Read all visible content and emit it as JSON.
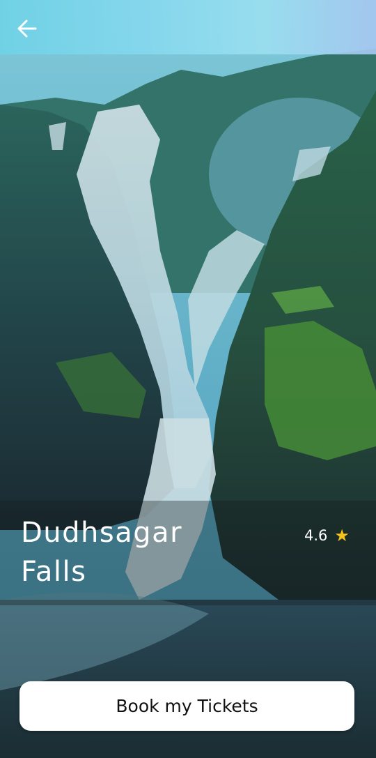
{
  "header": {
    "back_icon": "arrow-left-icon"
  },
  "place": {
    "name": "Dudhsagar Falls",
    "rating": "4.6",
    "rating_icon": "star-icon"
  },
  "actions": {
    "book_label": "Book my Tickets"
  },
  "colors": {
    "star": "#f6c21a",
    "header_tint": "#86d8ee",
    "button_bg": "#ffffff"
  }
}
